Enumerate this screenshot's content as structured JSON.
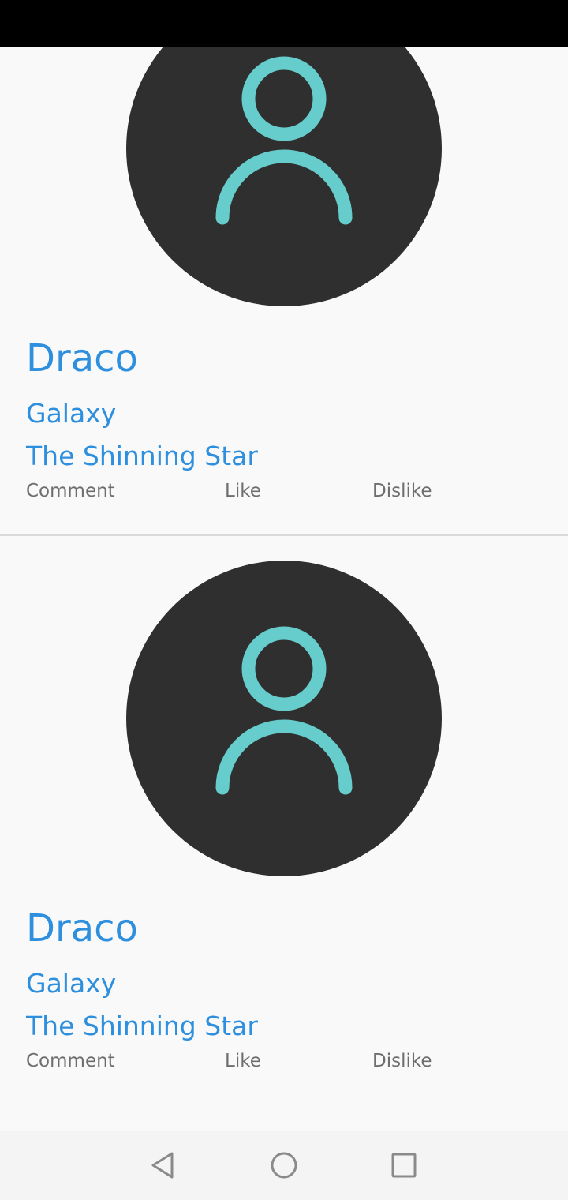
{
  "colors": {
    "title": "#2d8fdd",
    "action_text": "#6e6e6e",
    "avatar_bg": "#2f2f2f",
    "avatar_icon": "#66cccc",
    "page_bg": "#f9f9f9"
  },
  "posts": [
    {
      "avatar_icon": "person-icon",
      "name": "Draco",
      "subtitle": "Galaxy",
      "caption": "The Shinning Star",
      "actions": {
        "comment": "Comment",
        "like": "Like",
        "dislike": "Dislike"
      }
    },
    {
      "avatar_icon": "person-icon",
      "name": "Draco",
      "subtitle": "Galaxy",
      "caption": "The Shinning Star",
      "actions": {
        "comment": "Comment",
        "like": "Like",
        "dislike": "Dislike"
      }
    }
  ],
  "nav_bar": {
    "back_icon": "back-triangle-icon",
    "home_icon": "home-circle-icon",
    "recents_icon": "recents-square-icon"
  }
}
